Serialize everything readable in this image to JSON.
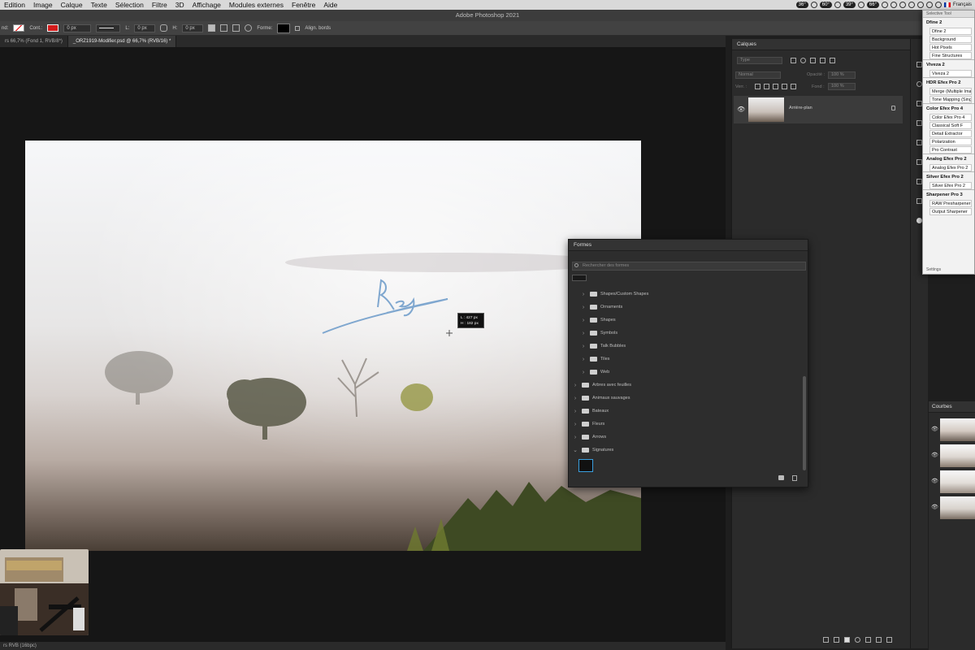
{
  "menubar": {
    "items": [
      "Edition",
      "Image",
      "Calque",
      "Texte",
      "Sélection",
      "Filtre",
      "3D",
      "Affichage",
      "Modules externes",
      "Fenêtre",
      "Aide"
    ],
    "pills": [
      "36°",
      "60°",
      "39°",
      "66°"
    ],
    "language": "Français"
  },
  "app_title": "Adobe Photoshop 2021",
  "options": {
    "fill_label": "nd:",
    "stroke_label": "Cont.:",
    "stroke_width": "0 px",
    "w_label": "L:",
    "w_value": "0 px",
    "h_label": "H:",
    "h_value": "0 px",
    "shape_label": "Forme:",
    "align_label": "Align. bords"
  },
  "tabs": [
    {
      "label": "rs 66,7% (Fond 1, RVB/8*)"
    },
    {
      "label": "_ORZ1919-Modifier.psd @ 66,7% (RVB/16) *"
    }
  ],
  "status": "rs RVB (16bpc)",
  "calques": {
    "title": "Calques",
    "search_placeholder": "Type",
    "blend": "Normal",
    "opacity_label": "Opacité :",
    "opacity_value": "100 %",
    "lock_label": "Verr. :",
    "fill_label": "Fond :",
    "fill_value": "100 %",
    "layer_name": "Arrière-plan"
  },
  "courbes": {
    "title": "Courbes"
  },
  "tooltip": {
    "l": "L : 427 px",
    "h": "H : 182 px"
  },
  "formes": {
    "title": "Formes",
    "search_placeholder": "Rechercher des formes",
    "subfolders": [
      "Shapes/Custom Shapes",
      "Ornaments",
      "Shapes",
      "Symbols",
      "Talk Bubbles",
      "Tiles",
      "Web"
    ],
    "folders": [
      "Arbres avec feuilles",
      "Animaux sauvages",
      "Bateaux",
      "Fleurs",
      "Arrows"
    ],
    "open_folder": "Signatures"
  },
  "plugin_menu": {
    "title": "Selective Tool",
    "groups": [
      {
        "title": "Dfine 2",
        "items": [
          "Dfine 2",
          "Background",
          "Hot Pixels",
          "Fine Structures"
        ]
      },
      {
        "title": "Viveza 2",
        "items": [
          "Viveza 2"
        ]
      },
      {
        "title": "HDR Efex Pro 2",
        "items": [
          "Merge (Multiple Imag",
          "Tone Mapping (Singl"
        ]
      },
      {
        "title": "Color Efex Pro 4",
        "items": [
          "Color Efex Pro 4",
          "Classical Soft F",
          "Detail Extractor",
          "Polarization",
          "Pro Contrast"
        ]
      },
      {
        "title": "Analog Efex Pro 2",
        "items": [
          "Analog Efex Pro 2"
        ]
      },
      {
        "title": "Silver Efex Pro 2",
        "items": [
          "Silver Efex Pro 2"
        ]
      },
      {
        "title": "Sharpener Pro 3",
        "items": [
          "RAW Presharpener",
          "Output Sharpener"
        ]
      }
    ],
    "settings": "Settings"
  }
}
